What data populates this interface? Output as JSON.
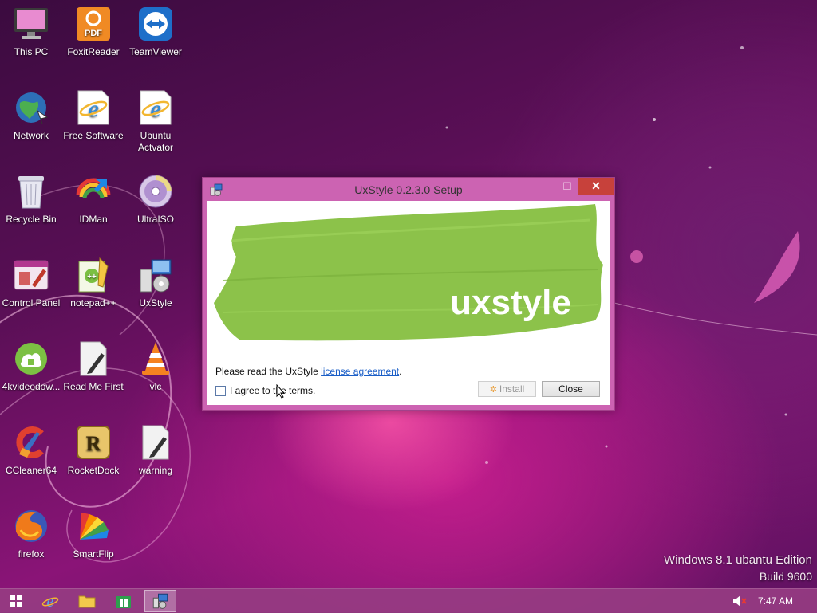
{
  "desktop": {
    "icons": [
      {
        "label": "This PC",
        "icon": "computer-icon"
      },
      {
        "label": "FoxitReader",
        "icon": "pdf-reader-icon",
        "badge": "PDF"
      },
      {
        "label": "TeamViewer",
        "icon": "teamviewer-icon"
      },
      {
        "label": "Network",
        "icon": "network-globe-icon"
      },
      {
        "label": "Free Software",
        "icon": "internet-explorer-icon"
      },
      {
        "label": "Ubuntu Actvator",
        "icon": "internet-explorer-icon"
      },
      {
        "label": "Recycle Bin",
        "icon": "recycle-bin-icon"
      },
      {
        "label": "IDMan",
        "icon": "download-manager-icon"
      },
      {
        "label": "UltraISO",
        "icon": "disc-icon"
      },
      {
        "label": "Control Panel",
        "icon": "control-panel-icon"
      },
      {
        "label": "notepad++",
        "icon": "notepad-plus-icon"
      },
      {
        "label": "UxStyle",
        "icon": "setup-icon"
      },
      {
        "label": "4kvideodow...",
        "icon": "cloud-download-icon"
      },
      {
        "label": "Read Me First",
        "icon": "document-icon"
      },
      {
        "label": "vlc",
        "icon": "vlc-cone-icon"
      },
      {
        "label": "CCleaner64",
        "icon": "ccleaner-icon"
      },
      {
        "label": "RocketDock",
        "icon": "rocketdock-icon",
        "badge": "R"
      },
      {
        "label": "warning",
        "icon": "document-icon"
      },
      {
        "label": "firefox",
        "icon": "firefox-icon"
      },
      {
        "label": "SmartFlip",
        "icon": "color-fan-icon"
      }
    ]
  },
  "watermark": {
    "edition": "Windows 8.1 ubantu Edition",
    "build": "Build 9600"
  },
  "dialog": {
    "title": "UxStyle 0.2.3.0 Setup",
    "banner_text": "uxstyle",
    "read_prefix": "Please read the UxStyle ",
    "license_link": "license agreement",
    "read_suffix": ".",
    "agree_label": "I agree to the terms.",
    "install_label": "Install",
    "close_label": "Close",
    "min_glyph": "—",
    "max_glyph": "☐",
    "close_glyph": "✕"
  },
  "taskbar": {
    "items": [
      "start-button",
      "internet-explorer",
      "file-explorer",
      "store",
      "uxstyle-setup"
    ],
    "clock": "7:47 AM"
  },
  "colors": {
    "accent": "#cc63b2",
    "banner_green": "#8cc24a",
    "close_red": "#c7413b"
  }
}
